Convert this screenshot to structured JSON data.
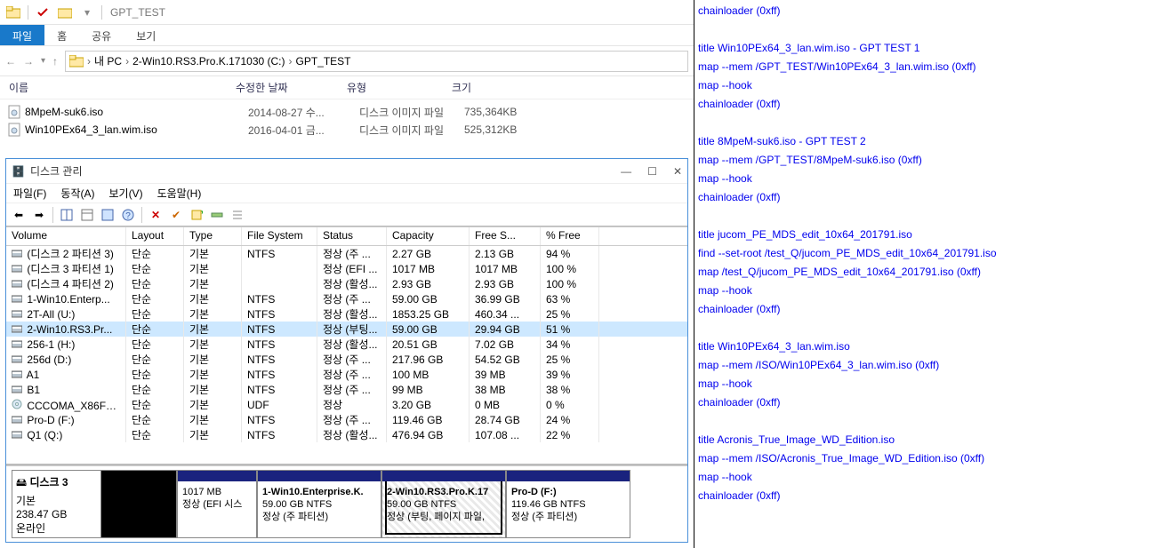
{
  "titlebar": {
    "title": "GPT_TEST"
  },
  "ribbon": {
    "file": "파일",
    "tabs": [
      "홈",
      "공유",
      "보기"
    ]
  },
  "breadcrumb": [
    "내 PC",
    "2-Win10.RS3.Pro.K.171030 (C:)",
    "GPT_TEST"
  ],
  "columns": {
    "name": "이름",
    "date": "수정한 날짜",
    "type": "유형",
    "size": "크기"
  },
  "files": [
    {
      "name": "8MpeM-suk6.iso",
      "date": "2014-08-27 수...",
      "type": "디스크 이미지 파일",
      "size": "735,364KB"
    },
    {
      "name": "Win10PEx64_3_lan.wim.iso",
      "date": "2016-04-01 금...",
      "type": "디스크 이미지 파일",
      "size": "525,312KB"
    }
  ],
  "dm": {
    "title": "디스크 관리",
    "menu": [
      "파일(F)",
      "동작(A)",
      "보기(V)",
      "도움말(H)"
    ],
    "cols": {
      "vol": "Volume",
      "lay": "Layout",
      "typ": "Type",
      "fs": "File System",
      "st": "Status",
      "cap": "Capacity",
      "free": "Free S...",
      "pf": "% Free"
    },
    "rows": [
      {
        "vol": "(디스크 2 파티션 3)",
        "lay": "단순",
        "typ": "기본",
        "fs": "NTFS",
        "st": "정상 (주 ...",
        "cap": "2.27 GB",
        "free": "2.13 GB",
        "pf": "94 %",
        "sel": false
      },
      {
        "vol": "(디스크 3 파티션 1)",
        "lay": "단순",
        "typ": "기본",
        "fs": "",
        "st": "정상 (EFI ...",
        "cap": "1017 MB",
        "free": "1017 MB",
        "pf": "100 %",
        "sel": false
      },
      {
        "vol": "(디스크 4 파티션 2)",
        "lay": "단순",
        "typ": "기본",
        "fs": "",
        "st": "정상 (활성...",
        "cap": "2.93 GB",
        "free": "2.93 GB",
        "pf": "100 %",
        "sel": false
      },
      {
        "vol": "1-Win10.Enterp...",
        "lay": "단순",
        "typ": "기본",
        "fs": "NTFS",
        "st": "정상 (주 ...",
        "cap": "59.00 GB",
        "free": "36.99 GB",
        "pf": "63 %",
        "sel": false
      },
      {
        "vol": "2T-All (U:)",
        "lay": "단순",
        "typ": "기본",
        "fs": "NTFS",
        "st": "정상 (활성...",
        "cap": "1853.25 GB",
        "free": "460.34 ...",
        "pf": "25 %",
        "sel": false
      },
      {
        "vol": "2-Win10.RS3.Pr...",
        "lay": "단순",
        "typ": "기본",
        "fs": "NTFS",
        "st": "정상 (부팅...",
        "cap": "59.00 GB",
        "free": "29.94 GB",
        "pf": "51 %",
        "sel": true
      },
      {
        "vol": "256-1 (H:)",
        "lay": "단순",
        "typ": "기본",
        "fs": "NTFS",
        "st": "정상 (활성...",
        "cap": "20.51 GB",
        "free": "7.02 GB",
        "pf": "34 %",
        "sel": false
      },
      {
        "vol": "256d (D:)",
        "lay": "단순",
        "typ": "기본",
        "fs": "NTFS",
        "st": "정상 (주 ...",
        "cap": "217.96 GB",
        "free": "54.52 GB",
        "pf": "25 %",
        "sel": false
      },
      {
        "vol": "A1",
        "lay": "단순",
        "typ": "기본",
        "fs": "NTFS",
        "st": "정상 (주 ...",
        "cap": "100 MB",
        "free": "39 MB",
        "pf": "39 %",
        "sel": false
      },
      {
        "vol": "B1",
        "lay": "단순",
        "typ": "기본",
        "fs": "NTFS",
        "st": "정상 (주 ...",
        "cap": "99 MB",
        "free": "38 MB",
        "pf": "38 %",
        "sel": false
      },
      {
        "vol": "CCCOMA_X86FR...",
        "lay": "단순",
        "typ": "기본",
        "fs": "UDF",
        "st": "정상",
        "cap": "3.20 GB",
        "free": "0 MB",
        "pf": "0 %",
        "sel": false,
        "cd": true
      },
      {
        "vol": "Pro-D (F:)",
        "lay": "단순",
        "typ": "기본",
        "fs": "NTFS",
        "st": "정상 (주 ...",
        "cap": "119.46 GB",
        "free": "28.74 GB",
        "pf": "24 %",
        "sel": false
      },
      {
        "vol": "Q1 (Q:)",
        "lay": "단순",
        "typ": "기본",
        "fs": "NTFS",
        "st": "정상 (활성...",
        "cap": "476.94 GB",
        "free": "107.08 ...",
        "pf": "22 %",
        "sel": false
      }
    ],
    "disk": {
      "name": "디스크 3",
      "type": "기본",
      "capacity": "238.47 GB",
      "status": "온라인",
      "parts": [
        {
          "title": "",
          "line2": "1017 MB",
          "line3": "정상 (EFI 시스",
          "w": 90,
          "sel": false,
          "empty": false,
          "leader": true
        },
        {
          "title": "1-Win10.Enterprise.K.",
          "line2": "59.00 GB NTFS",
          "line3": "정상 (주 파티션)",
          "w": 140,
          "sel": false
        },
        {
          "title": "2-Win10.RS3.Pro.K.17",
          "line2": "59.00 GB NTFS",
          "line3": "정상 (부팅, 페이지 파일,",
          "w": 140,
          "sel": true
        },
        {
          "title": "Pro-D  (F:)",
          "line2": "119.46 GB NTFS",
          "line3": "정상 (주 파티션)",
          "w": 140,
          "sel": false
        }
      ]
    }
  },
  "grub": [
    "chainloader (0xff)",
    "",
    "title Win10PEx64_3_lan.wim.iso - GPT TEST 1",
    "map --mem /GPT_TEST/Win10PEx64_3_lan.wim.iso (0xff)",
    "map --hook",
    "chainloader (0xff)",
    "",
    "title 8MpeM-suk6.iso - GPT TEST 2",
    "map --mem /GPT_TEST/8MpeM-suk6.iso (0xff)",
    "map --hook",
    "chainloader (0xff)",
    "",
    "title jucom_PE_MDS_edit_10x64_201791.iso",
    "find --set-root /test_Q/jucom_PE_MDS_edit_10x64_201791.iso",
    "map /test_Q/jucom_PE_MDS_edit_10x64_201791.iso (0xff)",
    "map --hook",
    "chainloader (0xff)",
    "",
    "title Win10PEx64_3_lan.wim.iso",
    "map --mem /ISO/Win10PEx64_3_lan.wim.iso (0xff)",
    "map --hook",
    "chainloader (0xff)",
    "",
    "title Acronis_True_Image_WD_Edition.iso",
    "map --mem /ISO/Acronis_True_Image_WD_Edition.iso (0xff)",
    "map --hook",
    "chainloader (0xff)"
  ]
}
